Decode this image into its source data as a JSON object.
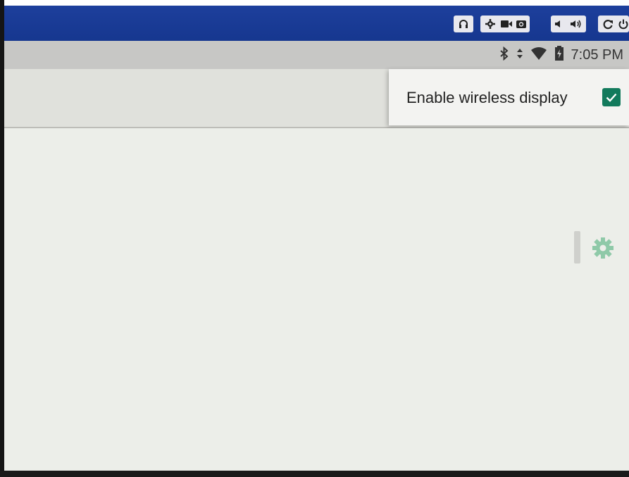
{
  "emulator_toolbar": {
    "buttons": [
      {
        "icon": "headset-icon"
      },
      {
        "icon": "gear-icon"
      },
      {
        "icon": "video-camera-icon"
      },
      {
        "icon": "camera-icon"
      },
      {
        "icon": "volume-down-icon"
      },
      {
        "icon": "volume-up-icon"
      },
      {
        "icon": "rotate-icon"
      },
      {
        "icon": "power-icon"
      }
    ],
    "accent_color": "#1d3f9c"
  },
  "status_bar": {
    "time": "7:05 PM",
    "icons": [
      "bluetooth-icon",
      "data-arrows-icon",
      "wifi-icon",
      "battery-icon"
    ]
  },
  "menu": {
    "items": [
      {
        "label": "Enable wireless display",
        "checked": true
      }
    ],
    "check_color": "#127a5c"
  },
  "content": {
    "settings_icon": "gear-icon",
    "settings_color": "#8fc9a8"
  }
}
